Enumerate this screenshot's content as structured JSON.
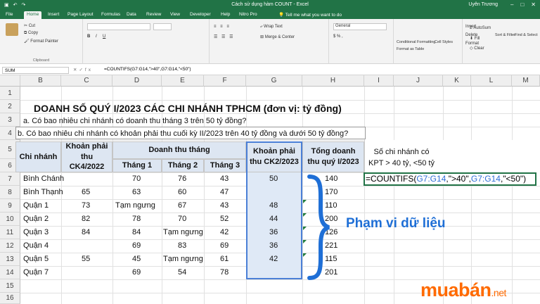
{
  "app": {
    "title": "Cách sử dụng hàm COUNT - Excel",
    "user": "Uyên Trương",
    "tabs": [
      "File",
      "Home",
      "Insert",
      "Page Layout",
      "Formulas",
      "Data",
      "Review",
      "View",
      "Developer",
      "Help",
      "Nitro Pro"
    ],
    "active_tab": "Home",
    "tell_me": "Tell me what you want to do"
  },
  "ribbon": {
    "cut": "Cut",
    "copy": "Copy",
    "format_painter": "Format Painter",
    "clipboard": "Clipboard",
    "wrap_text": "Wrap Text",
    "merge_center": "Merge & Center",
    "conditional_formatting": "Conditional Formatting",
    "format_as_table": "Format as Table",
    "cell_styles": "Cell Styles",
    "insert": "Insert",
    "delete": "Delete",
    "format": "Format",
    "autosum": "AutoSum",
    "fill": "Fill",
    "clear": "Clear",
    "sort_filter": "Sort & Filter",
    "find_select": "Find & Select",
    "general": "General"
  },
  "formula_bar": {
    "name_box": "SUM",
    "formula": "=COUNTIFS(G7:G14,\">40\",G7:G14,\"<50\")"
  },
  "columns": [
    "B",
    "C",
    "D",
    "E",
    "F",
    "G",
    "H",
    "I",
    "J",
    "K",
    "L",
    "M"
  ],
  "rows": [
    "1",
    "2",
    "3",
    "4",
    "5",
    "6",
    "7",
    "8",
    "9",
    "10",
    "11",
    "12",
    "13",
    "14",
    "15",
    "16"
  ],
  "sheet": {
    "title": "DOANH SỐ QUÝ I/2023 CÁC CHI NHÁNH TPHCM (đơn vị: tỷ đồng)",
    "q_a": "a. Có bao nhiêu chi nhánh có doanh thu tháng 3 trên 50 tỷ đồng?",
    "q_b": "b. Có bao nhiêu chi nhánh có khoản phải thu cuối kỳ II/2023 trên 40 tỷ đồng và dưới 50 tỷ đồng?",
    "h_branch": "Chi nhánh",
    "h_recv_ck4": "Khoản phải thu CK4/2022",
    "h_revenue": "Doanh thu tháng",
    "h_m1": "Tháng 1",
    "h_m2": "Tháng 2",
    "h_m3": "Tháng 3",
    "h_recv_ck2": "Khoản phải thu CK2/2023",
    "h_total": "Tổng doanh thu quý I/2023",
    "j_label": "Số chi nhánh có KPT > 40 tỷ, <50 tỷ",
    "j_formula_prefix": "=COUNTIFS(",
    "j_formula_ref1": "G7:G14",
    "j_formula_mid": ",\">40\",",
    "j_formula_ref2": "G7:G14",
    "j_formula_suffix": ",\"<50\")",
    "data_rows": [
      {
        "branch": "Bình Chánh",
        "c": "",
        "d": "70",
        "e": "76",
        "f": "43",
        "g": "50",
        "h": "140"
      },
      {
        "branch": "Bình Thạnh",
        "c": "65",
        "d": "63",
        "e": "60",
        "f": "47",
        "g": "",
        "h": "170"
      },
      {
        "branch": "Quận 1",
        "c": "73",
        "d": "Tạm ngưng",
        "e": "67",
        "f": "43",
        "g": "48",
        "h": "110"
      },
      {
        "branch": "Quận 2",
        "c": "82",
        "d": "78",
        "e": "70",
        "f": "52",
        "g": "44",
        "h": "200"
      },
      {
        "branch": "Quận 3",
        "c": "84",
        "d": "84",
        "e": "Tạm ngưng",
        "f": "42",
        "g": "36",
        "h": "126"
      },
      {
        "branch": "Quận 4",
        "c": "",
        "d": "69",
        "e": "83",
        "f": "69",
        "g": "36",
        "h": "221"
      },
      {
        "branch": "Quận 5",
        "c": "55",
        "d": "45",
        "e": "Tạm ngưng",
        "f": "61",
        "g": "42",
        "h": "115"
      },
      {
        "branch": "Quận 7",
        "c": "",
        "d": "69",
        "e": "54",
        "f": "78",
        "g": "",
        "h": "201"
      }
    ]
  },
  "annotation": {
    "label": "Phạm vi dữ liệu"
  },
  "watermark": {
    "main": "muabán",
    "suffix": ".net"
  },
  "colors": {
    "excel_green": "#217346",
    "accent_blue": "#1f6fd6",
    "watermark_orange": "#ff6a00"
  }
}
